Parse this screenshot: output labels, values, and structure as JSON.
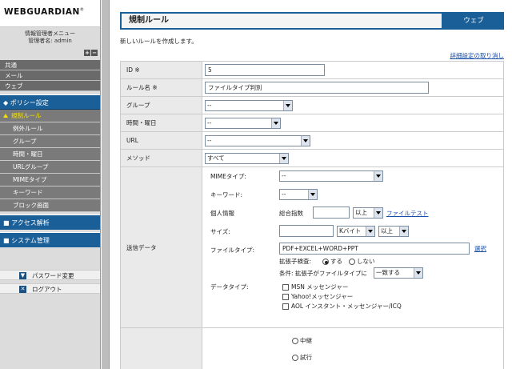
{
  "logo": {
    "text": "WEBGUARDIAN",
    "reg": "®"
  },
  "admin": {
    "menu_title": "情報管理者メニュー",
    "user_line": "管理者名: admin"
  },
  "sidebar": {
    "top_items": [
      "共通",
      "メール",
      "ウェブ"
    ],
    "policy_label": "◆ ポリシー設定",
    "policy_items": [
      "規制ルール",
      "例外ルール",
      "グループ",
      "時間・曜日",
      "URLグループ",
      "MIMEタイプ",
      "キーワード",
      "ブロック画面"
    ],
    "access_label": "■ アクセス解析",
    "system_label": "■ システム管理",
    "password_label": "パスワード変更",
    "logout_label": "ログアウト"
  },
  "main": {
    "title": "規制ルール",
    "tab": "ウェブ",
    "subtitle": "新しいルールを作成します。",
    "detail_link": "詳細設定の取り消し"
  },
  "form": {
    "id_label": "ID ※",
    "id_value": "5",
    "name_label": "ルール名 ※",
    "name_value": "ファイルタイプ判別",
    "group_label": "グループ",
    "group_value": "--",
    "time_label": "時間・曜日",
    "time_value": "--",
    "url_label": "URL",
    "url_value": "--",
    "method_label": "メソッド",
    "method_value": "すべて",
    "send_label": "送信データ",
    "mime_label": "MIMEタイプ:",
    "mime_value": "--",
    "keyword_label": "キーワード:",
    "keyword_value": "--",
    "personal_label": "個人情報",
    "score_label": "総合指数",
    "score_value": "",
    "score_cmp": "以上",
    "file_test": "ファイルテスト",
    "size_label": "サイズ:",
    "size_value": "",
    "size_unit": "Kバイト",
    "size_cmp": "以上",
    "filetype_label": "ファイルタイプ:",
    "filetype_value": "PDF+EXCEL+WORD+PPT",
    "select_link": "選択",
    "ext_check_label": "拡張子検査:",
    "ext_yes": "する",
    "ext_no": "しない",
    "cond_label": "条件: 拡張子がファイルタイプに",
    "cond_value": "一致する",
    "datatype_label": "データタイプ:",
    "dt_options": [
      "MSN メッセンジャー",
      "Yahoo!メッセンジャー",
      "AOL インスタント・メッセンジャー/ICQ"
    ],
    "action_options": [
      "中継",
      "試行"
    ]
  }
}
